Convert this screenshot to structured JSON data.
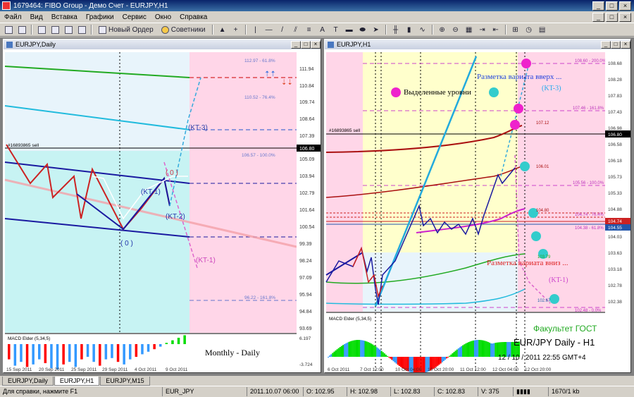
{
  "window": {
    "title": "1679464: FIBO Group - Демо Счет - EURJPY,H1",
    "minimize_glyph": "_",
    "maximize_glyph": "□",
    "close_glyph": "×"
  },
  "menu": [
    "Файл",
    "Вид",
    "Вставка",
    "Графики",
    "Сервис",
    "Окно",
    "Справка"
  ],
  "toolbar": {
    "new_order_label": "Новый Ордер",
    "advisors_label": "Советники",
    "text_tool_label": "A",
    "icons": [
      "new-chart-icon",
      "profiles-icon",
      "market-watch-icon",
      "navigator-icon",
      "terminal-icon",
      "tester-icon",
      "new-order-icon",
      "advisors-icon",
      "cursor-icon",
      "crosshair-icon",
      "vertical-line-icon",
      "horizontal-line-icon",
      "trendline-icon",
      "channel-icon",
      "fibo-icon",
      "text-icon",
      "label-icon",
      "rectangle-icon",
      "ellipse-icon",
      "arrows-icon",
      "bar-chart-icon",
      "candles-icon",
      "line-chart-icon",
      "zoom-in-icon",
      "zoom-out-icon",
      "tile-icon",
      "autoscroll-icon",
      "shift-icon",
      "indicators-icon",
      "periods-icon",
      "templates-icon"
    ]
  },
  "colors": {
    "up_bar": "#00dd00",
    "down_bar": "#ff0000",
    "blue_bar": "#3399ff",
    "pink_zone": "#ffd6e8",
    "yellow_zone": "#ffffcc",
    "cyan_zone": "#c7f3f3"
  },
  "chart_left": {
    "title": "EURJPY,Daily",
    "order_label": "#16893865 sell",
    "price_labels": [
      "111.94",
      "110.84",
      "109.74",
      "108.64",
      "107.39",
      "106.80",
      "105.09",
      "103.94",
      "102.79",
      "101.64",
      "100.54",
      "99.39",
      "98.24",
      "97.09",
      "95.94",
      "94.84",
      "93.69"
    ],
    "fibo_labels": [
      "112.97 - 61.8%",
      "110.52 - 76.4%",
      "106.57 - 100.0%",
      "96.22 - 161.8%"
    ],
    "kt_labels": [
      "(KT-3)",
      "( 0 )",
      "(KT-1)",
      "(KT-2)",
      "( 0 )",
      "(KT-1)"
    ],
    "indicator_label": "MACD Elder (5,34,5)",
    "indicator_levels": [
      "6.197",
      "-3.724"
    ],
    "dates": [
      "15 Sep 2011",
      "20 Sep 2011",
      "25 Sep 2011",
      "29 Sep 2011",
      "4 Oct 2011",
      "9 Oct 2011"
    ],
    "caption": "Monthly - Daily",
    "macd_bars": [
      -0.6,
      -0.85,
      -0.7,
      -0.9,
      -0.8,
      -0.6,
      -0.75,
      -0.95,
      -1.0,
      -0.8,
      -0.7,
      -0.9,
      -0.6,
      -0.5,
      -0.7,
      -0.85,
      -0.6,
      -0.55,
      -0.7,
      -0.8,
      -0.6,
      -0.5,
      -0.4,
      -0.3,
      -0.2,
      -0.1,
      0.05,
      0.15,
      0.25,
      0.35
    ]
  },
  "chart_right": {
    "title": "EURJPY,H1",
    "order_label": "#16893865 sell",
    "price_labels": [
      "108.68",
      "108.28",
      "107.83",
      "107.43",
      "106.98",
      "106.58",
      "106.18",
      "105.73",
      "105.33",
      "104.88",
      "104.48",
      "104.03",
      "103.63",
      "103.18",
      "102.78",
      "102.38"
    ],
    "current_price": "106.80",
    "right_prices": [
      "104.74",
      "104.55"
    ],
    "level_labels": [
      "108.60 - 200.0%",
      "107.46 - 161.8%",
      "107.12",
      "106.01",
      "105.56 - 100.0%",
      "104.80",
      "104.74 - 76.4%",
      "104.38 - 61.8%",
      "103.79",
      "102.67",
      "102.48 - 0.0%"
    ],
    "annotations": {
      "highlighted_levels": "Выделенные уровни",
      "markup_up": "Разметка вариата вверх ...",
      "markup_down": "Разметка вариата вниз ...",
      "kt3": "(KT-3)",
      "kt1": "(KT-1)",
      "faculty": "Факультет ГОСТ",
      "symbol_tf": "EUR/JPY Daily - H1",
      "datetime": "12 / 10 / 2011 22:55 GMT+4"
    },
    "indicator_label": "MACD Elder (5,34,5)",
    "dates": [
      "6 Oct 2011",
      "7 Oct 12:00",
      "10 Oct 04:00",
      "10 Oct 20:00",
      "11 Oct 12:00",
      "12 Oct 04:00",
      "12 Oct 20:00"
    ]
  },
  "tabs": [
    "EURJPY,Daily",
    "EURJPY,H1",
    "EURJPY,M15"
  ],
  "status": {
    "help": "Для справки, нажмите F1",
    "symbol": "EUR_JPY",
    "datetime": "2011.10.07 06:00",
    "open": "O: 102.95",
    "high": "H: 102.98",
    "low": "L: 102.83",
    "close": "C: 102.83",
    "volume": "V: 375",
    "traffic": "1670/1 kb"
  }
}
